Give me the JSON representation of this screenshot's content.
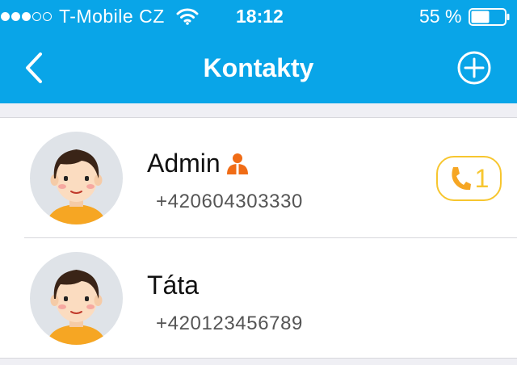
{
  "status_bar": {
    "carrier": "T-Mobile CZ",
    "signal_strength": 3,
    "signal_max": 5,
    "time": "18:12",
    "battery_percent_label": "55 %",
    "battery_level": 0.55
  },
  "nav_bar": {
    "title": "Kontakty",
    "back_icon": "chevron-left-icon",
    "add_icon": "plus-circle-icon"
  },
  "contacts": [
    {
      "name": "Admin",
      "phone": "+420604303330",
      "is_admin": true,
      "call_badge_count": "1",
      "avatar_icon": "boy-avatar-icon"
    },
    {
      "name": "Táta",
      "phone": "+420123456789",
      "is_admin": false,
      "avatar_icon": "boy-avatar-icon"
    }
  ],
  "colors": {
    "header": "#09a5e8",
    "admin_icon": "#f06c16",
    "call_badge": "#f7c62f",
    "avatar_background": "#dfe3e8"
  }
}
